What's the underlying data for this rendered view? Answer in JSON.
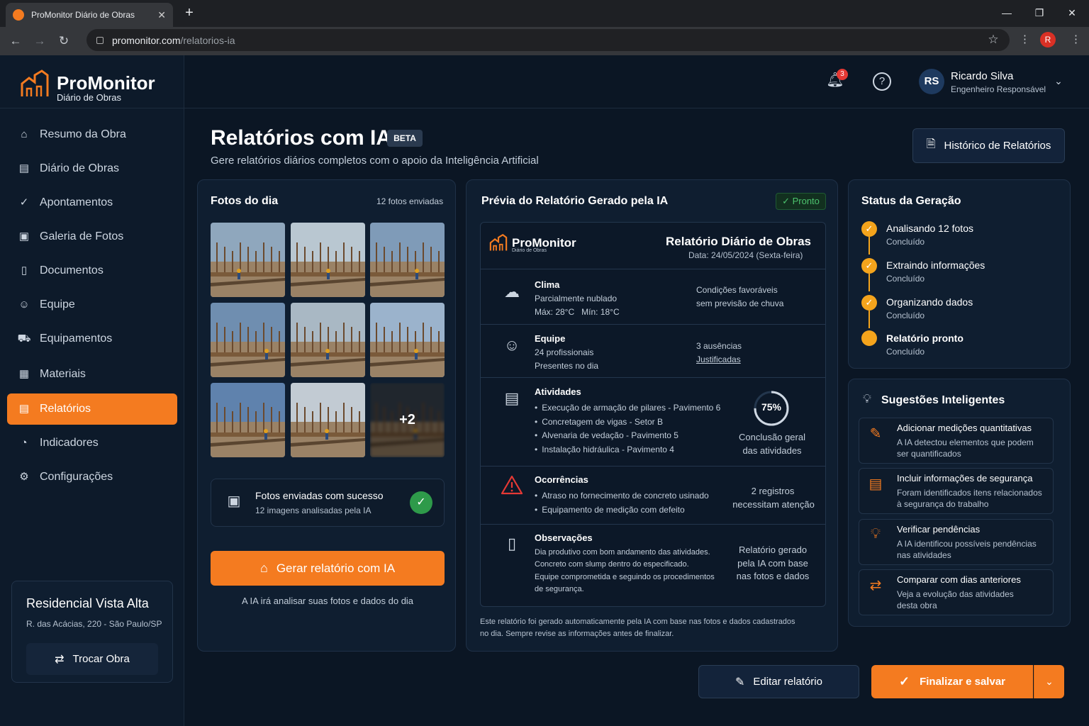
{
  "browser": {
    "tab_title": "ProMonitor Diário de Obras",
    "tab_close": "✕",
    "new_tab": "+",
    "url_host": "promonitor.com",
    "url_path": "/relatorios-ia",
    "profile_initial": "R"
  },
  "brand": {
    "name": "ProMonitor",
    "subtitle": "Diário de Obras",
    "accent": "#f47b20"
  },
  "sidebar": {
    "items": [
      {
        "label": "Resumo da Obra",
        "icon": "home-icon",
        "glyph": "⌂"
      },
      {
        "label": "Diário de Obras",
        "icon": "calendar-icon",
        "glyph": "▤"
      },
      {
        "label": "Apontamentos",
        "icon": "check-circle-icon",
        "glyph": "✓"
      },
      {
        "label": "Galeria de Fotos",
        "icon": "image-icon",
        "glyph": "▣"
      },
      {
        "label": "Documentos",
        "icon": "document-icon",
        "glyph": "▯"
      },
      {
        "label": "Equipe",
        "icon": "users-icon",
        "glyph": "☺"
      },
      {
        "label": "Equipamentos",
        "icon": "truck-icon",
        "glyph": "⛟"
      },
      {
        "label": "Materiais",
        "icon": "box-icon",
        "glyph": "▦"
      },
      {
        "label": "Relatórios",
        "icon": "report-icon",
        "glyph": "▤",
        "active": true
      },
      {
        "label": "Indicadores",
        "icon": "chart-icon",
        "glyph": "◔"
      },
      {
        "label": "Configurações",
        "icon": "gear-icon",
        "glyph": "⚙"
      }
    ],
    "project": {
      "name": "Residencial Vista Alta",
      "address": "R. das Acácias, 220 - São Paulo/SP",
      "switch_label": "Trocar Obra"
    }
  },
  "header": {
    "notifications_count": "3",
    "user": {
      "initials": "RS",
      "name": "Ricardo Silva",
      "role": "Engenheiro Responsável"
    }
  },
  "page": {
    "title": "Relatórios com IA",
    "badge": "BETA",
    "subtitle": "Gere relatórios diários completos com o apoio da Inteligência Artificial",
    "history_button": "Histórico de Relatórios"
  },
  "photos": {
    "title": "Fotos do dia",
    "count_label": "12 fotos enviadas",
    "more_label": "+2",
    "upload_title": "Fotos enviadas com sucesso",
    "upload_sub": "12 imagens analisadas pela IA",
    "generate_button": "Gerar relatório com IA",
    "generate_hint": "A IA irá analisar suas fotos e dados do dia"
  },
  "preview": {
    "title": "Prévia do Relatório Gerado pela IA",
    "status": "Pronto",
    "report": {
      "brand": "ProMonitor",
      "brand_sub": "Diário de Obras",
      "title": "Relatório Diário de Obras",
      "date": "Data: 24/05/2024 (Sexta-feira)",
      "clima": {
        "heading": "Clima",
        "line1": "Parcialmente nublado",
        "line2": "Máx: 28°C   Mín: 18°C",
        "right1": "Condições favoráveis",
        "right2": "sem previsão de chuva"
      },
      "equipe": {
        "heading": "Equipe",
        "line1": "24 profissionais",
        "line2": "Presentes no dia",
        "right1": "3 ausências",
        "right2": "Justificadas"
      },
      "atividades": {
        "heading": "Atividades",
        "items": [
          "Execução de armação de pilares - Pavimento 6",
          "Concretagem de vigas - Setor B",
          "Alvenaria de vedação - Pavimento 5",
          "Instalação hidráulica - Pavimento 4"
        ],
        "progress_label": "75%",
        "progress": 0.75,
        "right1": "Conclusão geral",
        "right2": "das atividades"
      },
      "ocorrencias": {
        "heading": "Ocorrências",
        "items": [
          "Atraso no fornecimento de concreto usinado",
          "Equipamento de medição com defeito"
        ],
        "right1": "2 registros",
        "right2": "necessitam atenção"
      },
      "observacoes": {
        "heading": "Observações",
        "line1": "Dia produtivo com bom andamento das atividades.",
        "line2": "Concreto com slump dentro do especificado.",
        "line3": "Equipe comprometida e seguindo os procedimentos",
        "line4": "de segurança.",
        "right1": "Relatório gerado",
        "right2": "pela IA com base",
        "right3": "nas fotos e dados"
      }
    },
    "footer1": "Este relatório foi gerado automaticamente pela IA com base nas fotos e dados cadastrados",
    "footer2": "no dia. Sempre revise as informações antes de finalizar."
  },
  "status": {
    "title": "Status da Geração",
    "steps": [
      {
        "name": "Analisando 12 fotos",
        "state": "Concluído"
      },
      {
        "name": "Extraindo informações",
        "state": "Concluído"
      },
      {
        "name": "Organizando dados",
        "state": "Concluído"
      },
      {
        "name": "Relatório pronto",
        "state": "Concluído"
      }
    ]
  },
  "suggestions": {
    "title": "Sugestões Inteligentes",
    "items": [
      {
        "title": "Adicionar medições quantitativas",
        "line1": "A IA detectou elementos que podem",
        "line2": "ser quantificados",
        "icon": "edit-doc-icon"
      },
      {
        "title": "Incluir informações de segurança",
        "line1": "Foram identificados itens relacionados",
        "line2": "à segurança do trabalho",
        "icon": "clipboard-icon"
      },
      {
        "title": "Verificar pendências",
        "line1": "A IA identificou possíveis pendências",
        "line2": "nas atividades",
        "icon": "lightbulb-icon"
      },
      {
        "title": "Comparar com dias anteriores",
        "line1": "Veja a evolução das atividades",
        "line2": "desta obra",
        "icon": "compare-icon"
      }
    ]
  },
  "actions": {
    "edit_label": "Editar relatório",
    "finalize_label": "Finalizar e salvar"
  }
}
